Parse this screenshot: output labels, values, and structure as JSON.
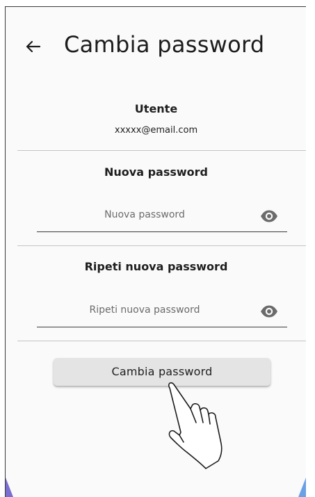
{
  "header": {
    "title": "Cambia password",
    "back_icon": "arrow-left-icon"
  },
  "user_section": {
    "heading": "Utente",
    "email": "xxxxx@email.com"
  },
  "new_password": {
    "heading": "Nuova password",
    "placeholder": "Nuova password",
    "value": "",
    "toggle_icon": "eye-icon"
  },
  "repeat_password": {
    "heading": "Ripeti nuova password",
    "placeholder": "Ripeti nuova password",
    "value": "",
    "toggle_icon": "eye-icon"
  },
  "submit": {
    "label": "Cambia password"
  },
  "overlay": {
    "pointer_icon": "hand-pointer-icon"
  },
  "colors": {
    "background": "#fafafa",
    "text": "#1e1e1e",
    "divider": "#c4c4c4",
    "button_bg": "#e4e4e4",
    "corner_left": "#7a6fd0",
    "corner_right": "#6aa0e6"
  }
}
